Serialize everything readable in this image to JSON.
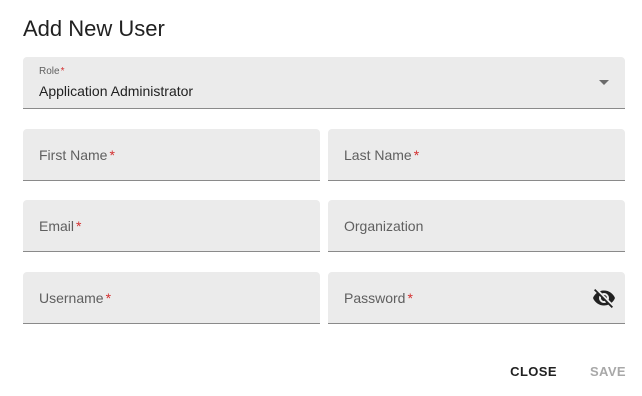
{
  "dialog": {
    "title": "Add New User"
  },
  "form": {
    "role": {
      "label": "Role",
      "required_mark": "*",
      "value": "Application Administrator",
      "icon": "chevron-down-icon"
    },
    "first_name": {
      "label": "First Name",
      "required_mark": "*"
    },
    "last_name": {
      "label": "Last Name",
      "required_mark": "*"
    },
    "email": {
      "label": "Email",
      "required_mark": "*"
    },
    "organization": {
      "label": "Organization"
    },
    "username": {
      "label": "Username",
      "required_mark": "*"
    },
    "password": {
      "label": "Password",
      "required_mark": "*",
      "icon": "eye-off-icon"
    }
  },
  "actions": {
    "close_label": "CLOSE",
    "save_label": "SAVE"
  },
  "colors": {
    "field_background": "#ebebeb",
    "required": "#d32f2f",
    "disabled_text": "#a8a8a8"
  }
}
